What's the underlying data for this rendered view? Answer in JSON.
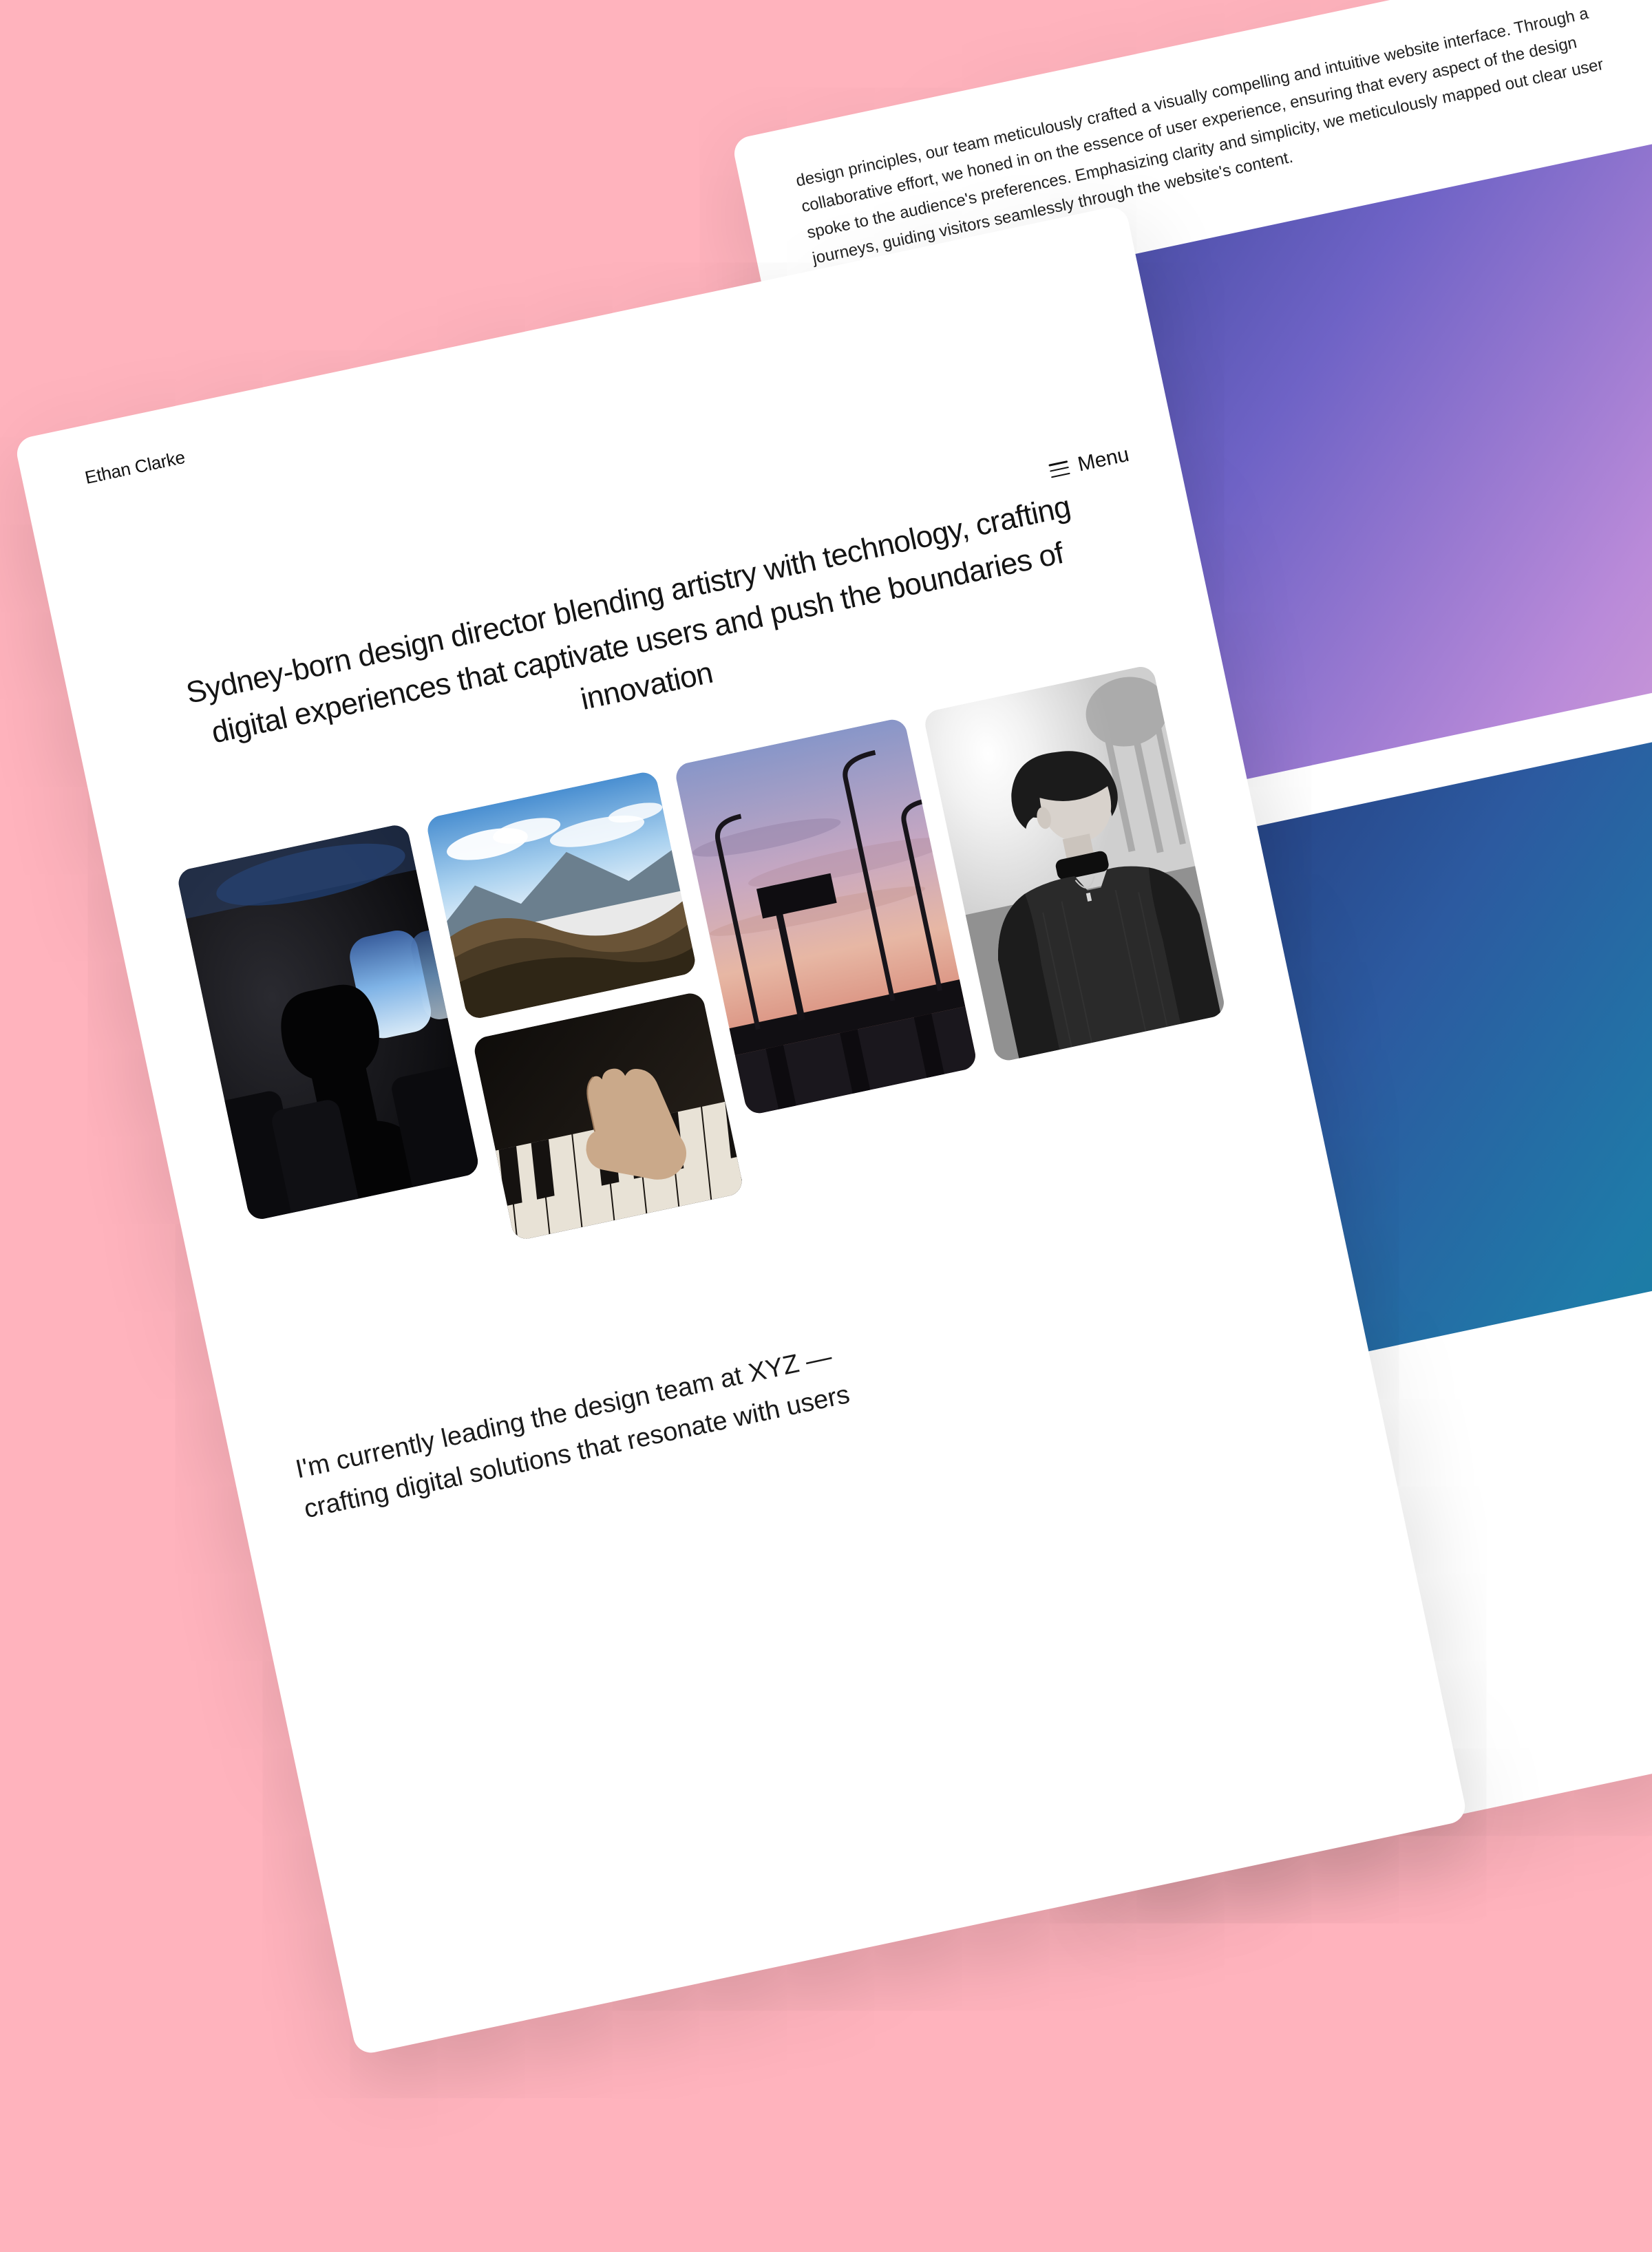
{
  "brand": "Ethan Clarke",
  "menu": {
    "label": "Menu"
  },
  "hero": "Sydney-born design director blending artistry with technology, crafting digital experiences that captivate users and push the boundaries of innovation",
  "gallery": {
    "items": [
      {
        "name": "airplane-interior"
      },
      {
        "name": "mountain-landscape"
      },
      {
        "name": "piano-hands"
      },
      {
        "name": "highway-sunset"
      },
      {
        "name": "portrait-bw"
      }
    ]
  },
  "body": "I'm currently leading the design team at XYZ — crafting digital solutions that resonate with users",
  "back": {
    "paragraph": "design principles, our team meticulously crafted a visually compelling and intuitive website interface. Through a collaborative effort, we honed in on the essence of user experience, ensuring that every aspect of the design spoke to the audience's preferences. Emphasizing clarity and simplicity, we meticulously mapped out clear user journeys, guiding visitors seamlessly through the website's content."
  },
  "colors": {
    "page_bg": "#ffb3bd",
    "card_bg": "#ffffff",
    "text": "#141414"
  }
}
